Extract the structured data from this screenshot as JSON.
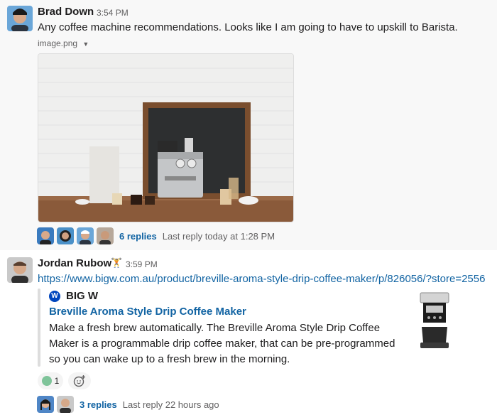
{
  "messages": [
    {
      "author": "Brad Down",
      "time": "3:54 PM",
      "text": "Any coffee machine recommendations. Looks like I am going to have to upskill to Barista.",
      "file": {
        "name": "image.png",
        "dropdown_icon": "caret-down-icon"
      },
      "thread": {
        "replies": "6 replies",
        "last_reply": "Last reply today at 1:28 PM"
      }
    },
    {
      "author": "Jordan Rubow",
      "status_emoji": "🏋",
      "time": "3:59 PM",
      "link": "https://www.bigw.com.au/product/breville-aroma-style-drip-coffee-maker/p/826056/?store=2556",
      "unfurl": {
        "site_logo_letter": "W",
        "site_name": "BIG W",
        "title": "Breville Aroma Style Drip Coffee Maker",
        "description": "Make a fresh brew automatically. The Breville Aroma Style Drip Coffee Maker is a programmable drip coffee maker, that can be pre-programmed so you can wake up to a fresh brew in the morning."
      },
      "reaction": {
        "emoji_icon": "sick-face-emoji",
        "count": "1"
      },
      "add_reaction_icon": "add-reaction-icon",
      "thread": {
        "replies": "3 replies",
        "last_reply": "Last reply 22 hours ago"
      }
    }
  ],
  "colors": {
    "link": "#1264a3",
    "muted": "#616061",
    "text": "#1d1c1d",
    "hover_bg": "#f8f8f8",
    "bigw_blue": "#0046be"
  }
}
